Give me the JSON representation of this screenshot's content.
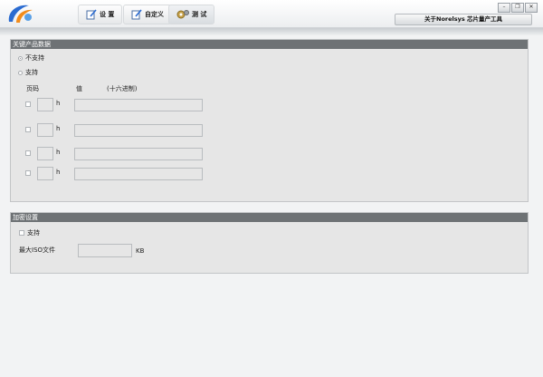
{
  "tabs": [
    {
      "label": "设 置"
    },
    {
      "label": "自定义"
    },
    {
      "label": "测 试"
    }
  ],
  "about_label": "关于Norelsys 芯片量产工具",
  "product_panel": {
    "title": "关键产品数据",
    "radio_not_supported": "不支持",
    "radio_supported": "支持",
    "col_page": "页码",
    "col_value": "值",
    "col_hex": "(十六进制)",
    "hex_suffix": "h",
    "rows": 4
  },
  "encrypt_panel": {
    "title": "加密设置",
    "support_label": "支持",
    "max_iso_label": "最大ISO文件",
    "unit": "KB"
  },
  "colors": {
    "panel_header": "#6e7275",
    "panel_bg": "#e6e6e6",
    "accent_blue": "#2a6bd1",
    "accent_orange": "#f28c1c"
  }
}
